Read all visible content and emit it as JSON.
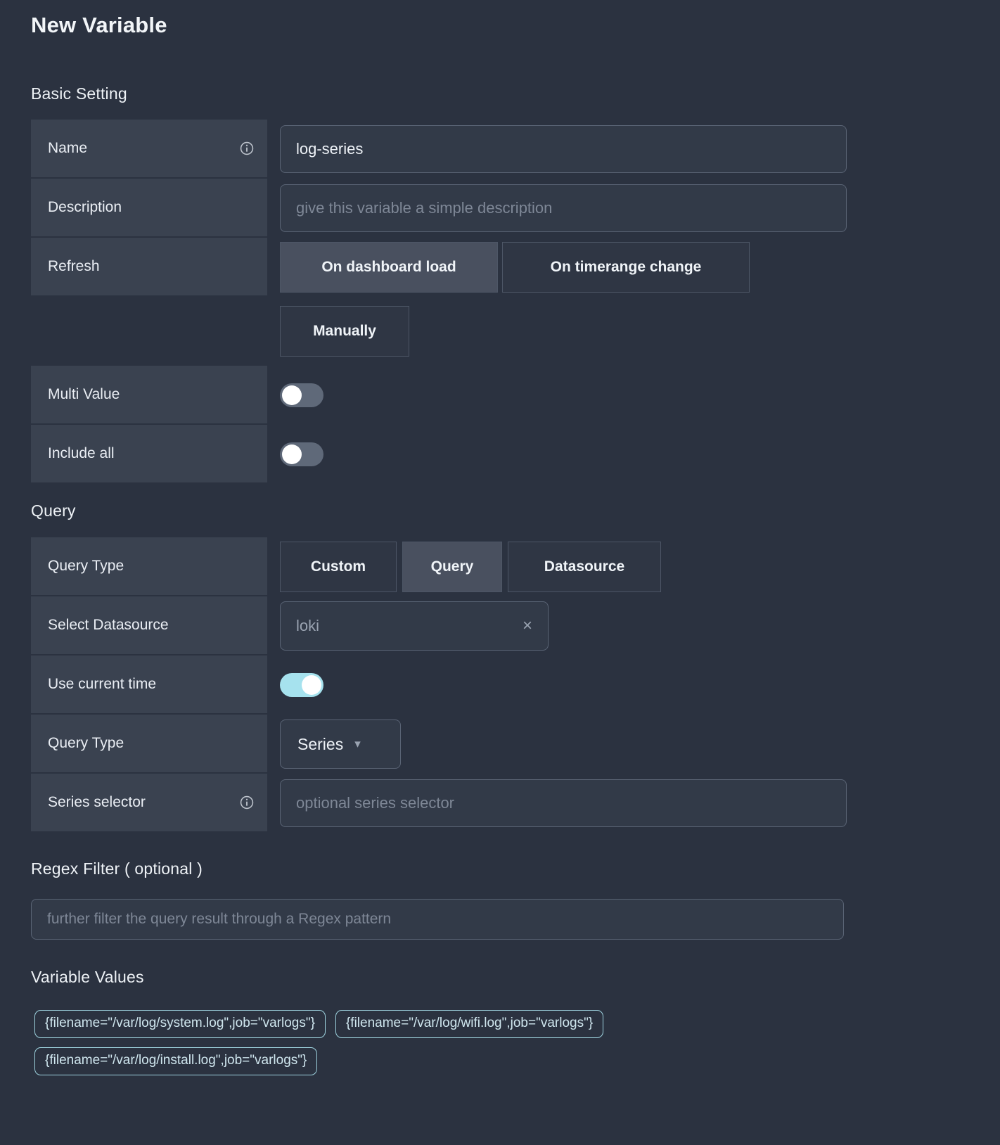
{
  "page": {
    "title": "New Variable"
  },
  "basic": {
    "heading": "Basic Setting",
    "name": {
      "label": "Name",
      "info_icon": "info-icon",
      "value": "log-series"
    },
    "description": {
      "label": "Description",
      "value": "",
      "placeholder": "give this variable a simple description"
    },
    "refresh": {
      "label": "Refresh",
      "options": [
        "On dashboard load",
        "On timerange change",
        "Manually"
      ],
      "selected": "On dashboard load"
    },
    "multi_value": {
      "label": "Multi Value",
      "state": "off"
    },
    "include_all": {
      "label": "Include all",
      "state": "off"
    }
  },
  "query": {
    "heading": "Query",
    "query_type": {
      "label": "Query Type",
      "options": [
        "Custom",
        "Query",
        "Datasource"
      ],
      "selected": "Query"
    },
    "select_datasource": {
      "label": "Select Datasource",
      "value": "loki",
      "clear_icon": "×"
    },
    "use_current_time": {
      "label": "Use current time",
      "state": "on"
    },
    "sub_query_type": {
      "label": "Query Type",
      "selected": "Series",
      "chevron": "⌄"
    },
    "series_selector": {
      "label": "Series selector",
      "info_icon": "info-icon",
      "value": "",
      "placeholder": "optional series selector"
    }
  },
  "regex": {
    "heading": "Regex Filter ( optional )",
    "value": "",
    "placeholder": "further filter the query result through a Regex pattern"
  },
  "variable_values": {
    "heading": "Variable Values",
    "items": [
      "{filename=\"/var/log/system.log\",job=\"varlogs\"}",
      "{filename=\"/var/log/wifi.log\",job=\"varlogs\"}",
      "{filename=\"/var/log/install.log\",job=\"varlogs\"}"
    ]
  },
  "colors": {
    "background": "#2b3240",
    "label_cell": "#3a4250",
    "accent_toggle_on": "#a6e2ee",
    "chip_border": "#9fd4e0",
    "segment_active": "#49505f"
  }
}
